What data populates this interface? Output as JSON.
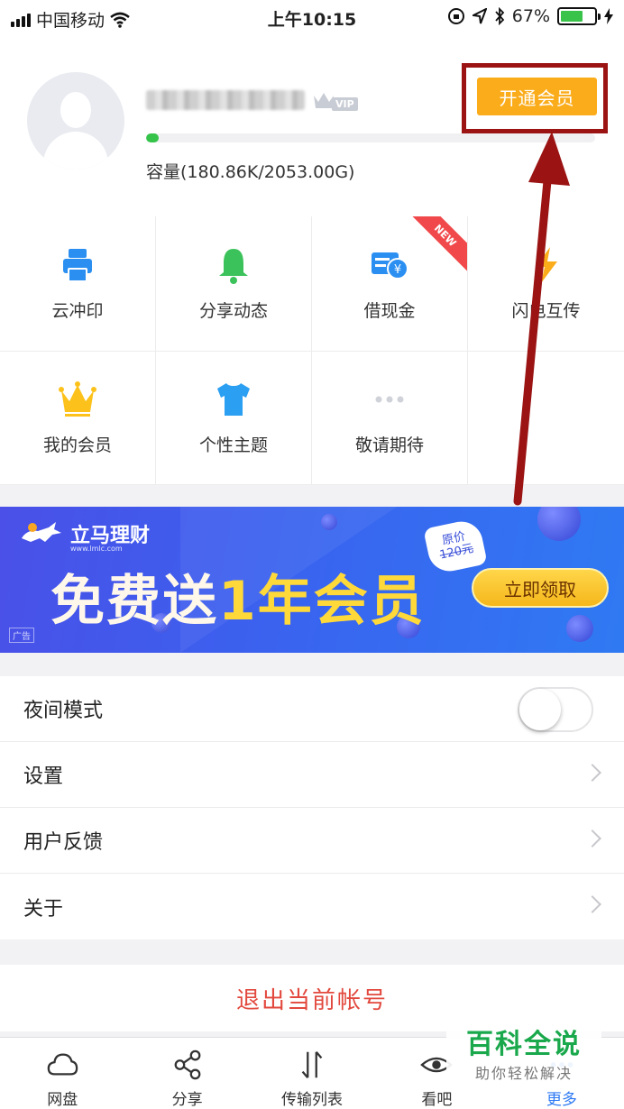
{
  "status_bar": {
    "carrier": "中国移动",
    "time": "上午10:15",
    "battery": "67%",
    "battery_level": 0.67
  },
  "profile": {
    "vip_badge": "VIP",
    "storage_used_fraction": 0.0001,
    "capacity": "容量(180.86K/2053.00G)",
    "open_vip_button": "开通会员"
  },
  "grid": {
    "items": [
      {
        "label": "云冲印",
        "icon": "printer-icon"
      },
      {
        "label": "分享动态",
        "icon": "bell-icon"
      },
      {
        "label": "借现金",
        "icon": "cash-card-icon",
        "badge": "NEW"
      },
      {
        "label": "闪电互传",
        "icon": "lightning-icon"
      },
      {
        "label": "我的会员",
        "icon": "crown-icon"
      },
      {
        "label": "个性主题",
        "icon": "tshirt-icon"
      },
      {
        "label": "敬请期待",
        "icon": "more-dots-icon"
      }
    ]
  },
  "banner": {
    "brand": "立马理财",
    "brand_url": "www.lmlc.com",
    "headline_prefix": "免费送",
    "headline_highlight": "1年会员",
    "original_price_label": "原价",
    "original_price": "120元",
    "claim_button": "立即领取",
    "ad_label": "广告"
  },
  "settings": {
    "night_mode": "夜间模式",
    "night_mode_on": false,
    "settings": "设置",
    "feedback": "用户反馈",
    "about": "关于"
  },
  "logout": "退出当前帐号",
  "tabbar": {
    "tabs": [
      {
        "label": "网盘",
        "icon": "cloud-icon"
      },
      {
        "label": "分享",
        "icon": "share-icon"
      },
      {
        "label": "传输列表",
        "icon": "transfer-icon"
      },
      {
        "label": "看吧",
        "icon": "eye-icon"
      },
      {
        "label": "更多",
        "icon": "more-icon",
        "active": true
      }
    ]
  },
  "watermark": {
    "title": "百科全说",
    "subtitle": "助你轻松解决"
  },
  "colors": {
    "accent_blue": "#2f7af3",
    "vip_orange": "#fbac1b",
    "annotation_red": "#9b1313",
    "logout_red": "#e2483d",
    "progress_green": "#35c34a"
  }
}
